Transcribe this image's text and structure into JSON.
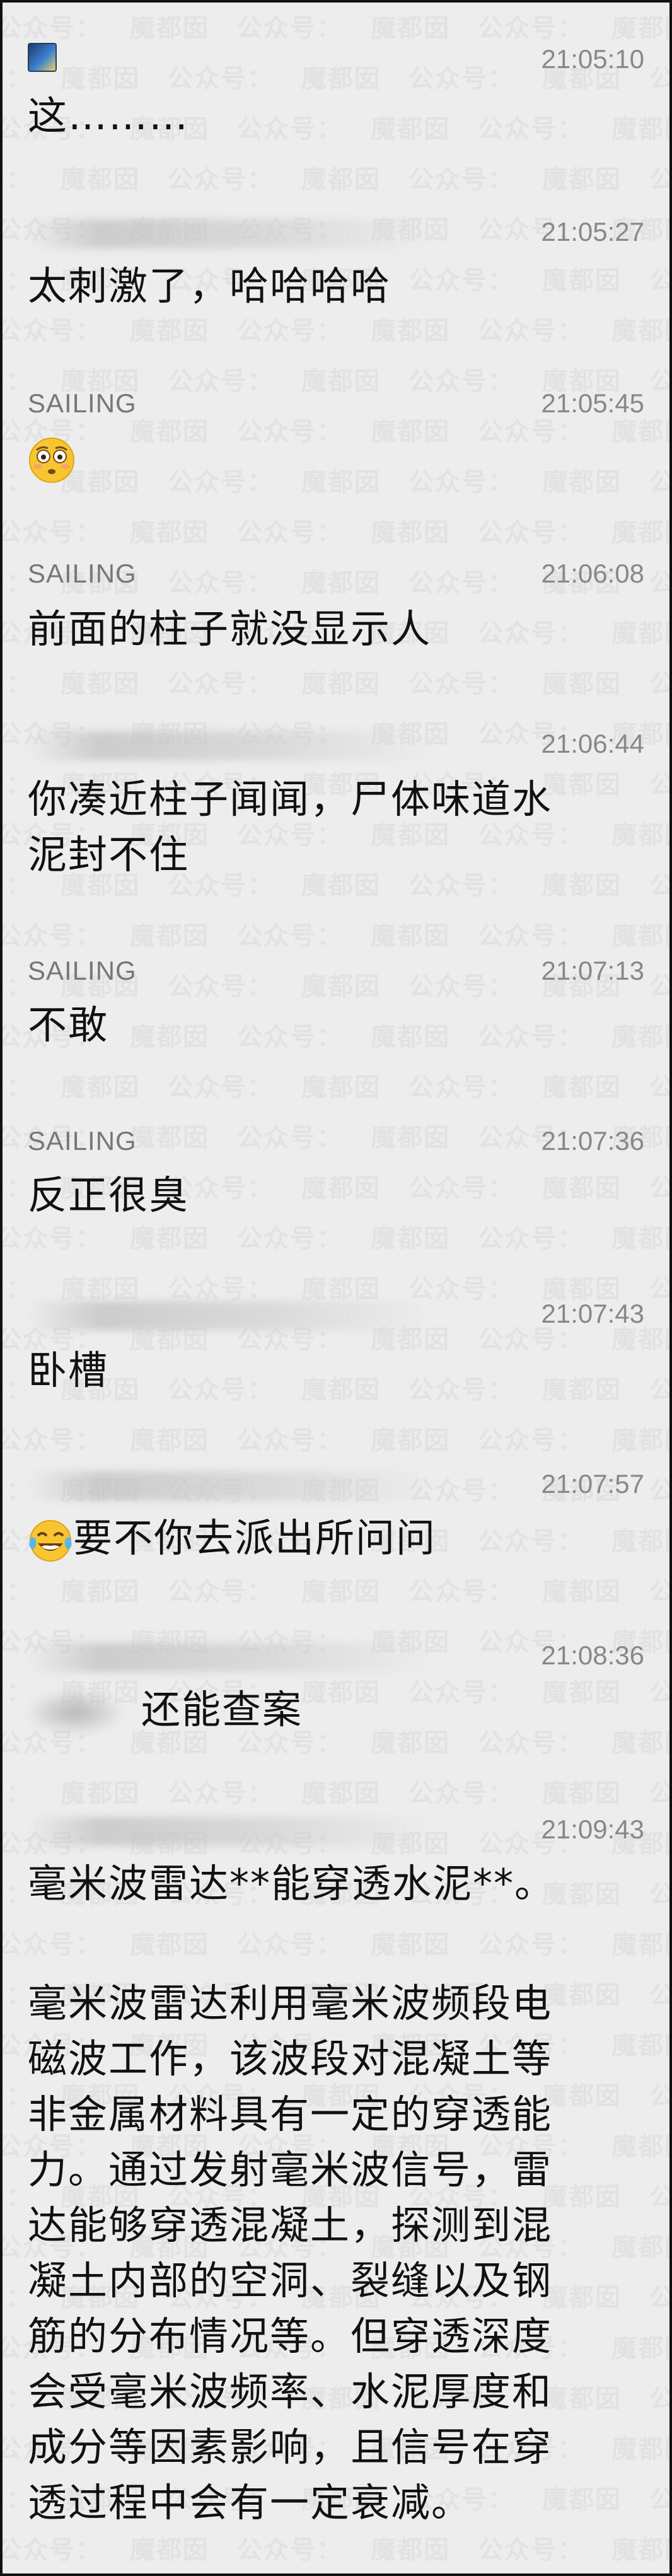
{
  "messages": [
    {
      "sender": "",
      "sender_icon": "landscape-avatar-icon",
      "time": "21:05:10",
      "text": "这………"
    },
    {
      "sender": "",
      "sender_blurred": true,
      "time": "21:05:27",
      "text": "太刺激了，哈哈哈哈"
    },
    {
      "sender": "SAILING",
      "time": "21:05:45",
      "emoji": "flushed-face-emoji"
    },
    {
      "sender": "SAILING",
      "time": "21:06:08",
      "text": "前面的柱子就没显示人"
    },
    {
      "sender": "",
      "sender_blurred": true,
      "time": "21:06:44",
      "text_lines": [
        "你凑近柱子闻闻，尸体味道水",
        "泥封不住"
      ]
    },
    {
      "sender": "SAILING",
      "time": "21:07:13",
      "text": "不敢"
    },
    {
      "sender": "SAILING",
      "time": "21:07:36",
      "text": "反正很臭"
    },
    {
      "sender": "",
      "sender_blurred": true,
      "time": "21:07:43",
      "text": "卧槽"
    },
    {
      "sender": "",
      "sender_blurred": true,
      "time": "21:07:57",
      "emoji": "tears-of-joy-emoji",
      "text": "要不你去派出所问问"
    },
    {
      "sender": "",
      "sender_blurred": true,
      "time": "21:08:36",
      "mention_blurred": true,
      "text": "还能查案"
    },
    {
      "sender": "",
      "sender_blurred": true,
      "time": "21:09:43",
      "text": "毫米波雷达**能穿透水泥**。",
      "paragraph_lines": [
        "毫米波雷达利用毫米波频段电",
        "磁波工作，该波段对混凝土等",
        "非金属材料具有一定的穿透能",
        "力。通过发射毫米波信号，雷",
        "达能够穿透混凝土，探测到混",
        "凝土内部的空洞、裂缝以及钢",
        "筋的分布情况等。但穿透深度",
        "会受毫米波频率、水泥厚度和",
        "成分等因素影响，且信号在穿",
        "透过程中会有一定衰减。"
      ]
    }
  ],
  "watermark": {
    "a": "公众号：",
    "b": "魔都囡"
  },
  "colors": {
    "background": "#ededed",
    "text": "#111111",
    "time": "#888888",
    "sender": "#777777"
  }
}
